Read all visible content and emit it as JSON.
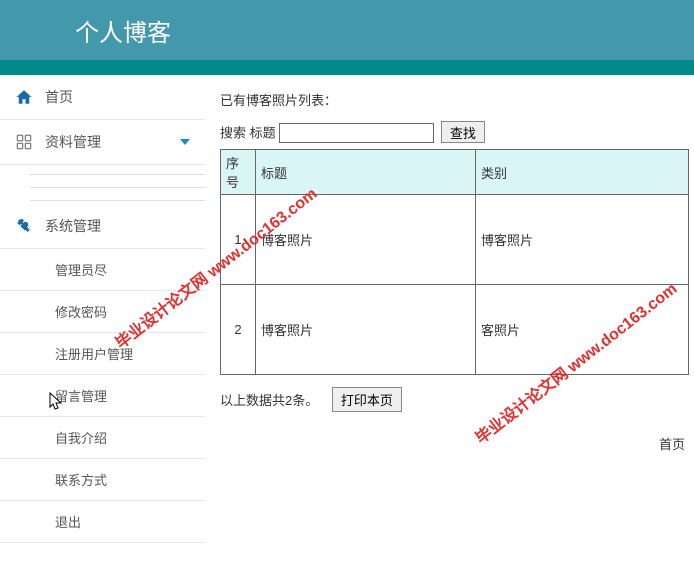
{
  "header": {
    "title": "个人博客"
  },
  "sidebar": {
    "home": "首页",
    "data_manage": "资料管理",
    "sys_manage": "系统管理",
    "submenu": [
      "管理员尽",
      "修改密码",
      "注册用户管理",
      "留言管理",
      "自我介绍",
      "联系方式",
      "退出"
    ]
  },
  "main": {
    "list_title": "已有博客照片列表：",
    "search_label": "搜索",
    "field_label": "标题",
    "search_button": "查找",
    "headers": {
      "seq": "序号",
      "title": "标题",
      "category": "类别"
    },
    "rows": [
      {
        "seq": "1",
        "title": "博客照片",
        "category": "博客照片"
      },
      {
        "seq": "2",
        "title": "博客照片",
        "category": "客照片"
      }
    ],
    "summary": "以上数据共2条。",
    "print": "打印本页",
    "page_first": "首页"
  },
  "watermark": "毕业设计论文网 www.doc163.com"
}
